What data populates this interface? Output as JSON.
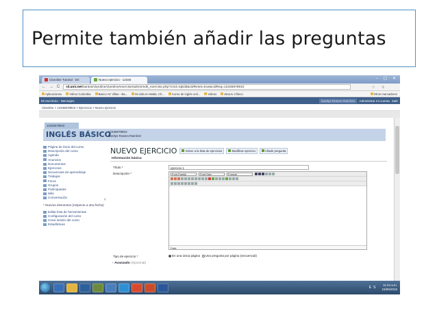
{
  "slide_title": "Permite también añadir las preguntas",
  "browser": {
    "tabs": [
      "Claroline Tutorial - Dri",
      "Nuevo ejercicio - 12345"
    ],
    "window_controls": "– ▢ ✕",
    "nav_buttons": [
      "←",
      "→",
      "C"
    ],
    "url_host": "rd.unir.net",
    "url_path": "/santos/claroline/claroline/exercise/admin/edit_exercise.php?cmd=rqEdit&cidReset=true&cidReq=12345678910",
    "addr_icons": "☆ ≡",
    "bookmarks": [
      "Aplicaciones",
      "Yahoo Colombia",
      "Banco AV Villas - Ba...",
      "Mi vida en Malta, Ch...",
      "Curso de inglés onli...",
      "Videos",
      "Zeta.tv Clínico"
    ],
    "bookmarks_other": "Otros marcadores"
  },
  "claroline": {
    "topbar_left": "Mi escritorio · Mensajes",
    "user": "karelys Rosero Ramírez",
    "admin": "Administrar mi cuenta",
    "logout": "Salir",
    "breadcrumb": "Claroline > 12345678910 > Ejercicios > Nuevo ejercicio",
    "course_code": "12345678910",
    "course_title": "INGLÉS BÁSICO",
    "course_meta_code": "12345678910",
    "course_meta_owner": "karelys Rosero Ramírez",
    "collapse_glyph": "‹",
    "sidebar": [
      "Página de inicio del curso",
      "Descripción del curso",
      "Agenda",
      "Anuncios",
      "Documentos",
      "Ejercicios",
      "Secuencias de aprendizaje",
      "Trabajos",
      "Foros",
      "Grupos",
      "Participantes",
      "Wiki",
      "Conversación"
    ],
    "sidebar_note": "Nuevos elementos (respecto a otra fecha)",
    "sidebar_tools": [
      "Editar lista de herramientas",
      "Configuración del curso",
      "Crear sesión del curso",
      "Estadísticas"
    ],
    "page_heading": "NUEVO EJERCICIO",
    "actions": [
      "Volver a la lista de ejercicios",
      "Modificar ejercicio",
      "Añadir pregunta"
    ],
    "section_basic": "Información básica",
    "label_title": "Título *",
    "value_title": "ejercicio 1",
    "label_desc": "Descripción *",
    "editor_font_family": "Font Family",
    "editor_font_size": "Font Size",
    "editor_format": "Format",
    "editor_path": "Path:",
    "label_type": "Tipo de ejercicio *",
    "type_opt1": "En una única página",
    "type_opt2": "Una pregunta por página (secuencial)",
    "advanced": "Avanzado",
    "advanced_note": "(Opcional)"
  },
  "taskbar": {
    "tray_lang": "ES",
    "time": "11:44 a.m.",
    "date": "15/06/2015"
  }
}
